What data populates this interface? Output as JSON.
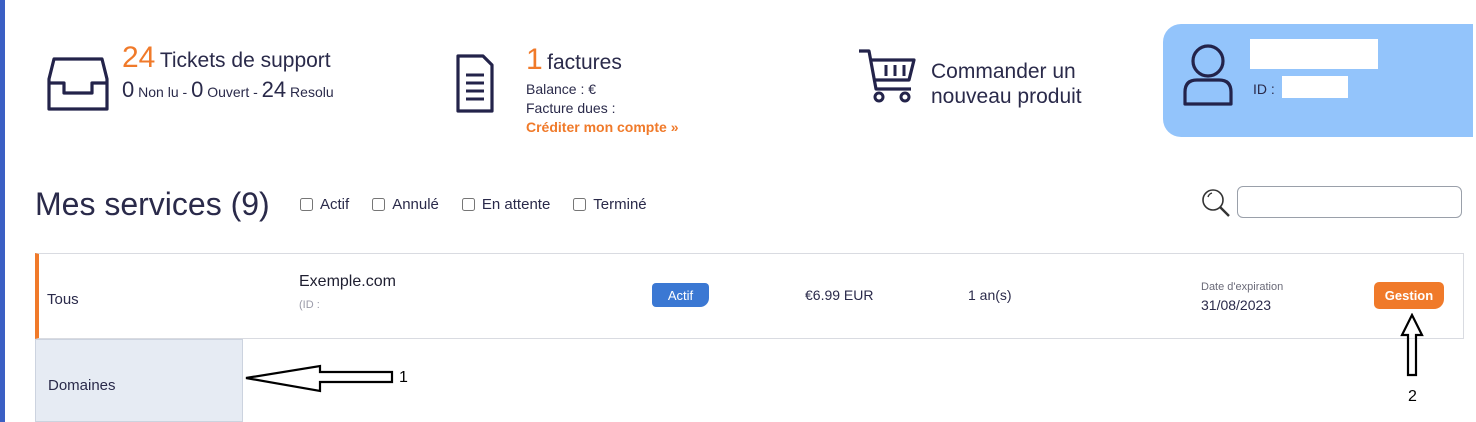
{
  "stats": {
    "tickets": {
      "count": "24",
      "title": "Tickets de support",
      "unread_count": "0",
      "unread_label": "Non lu",
      "open_count": "0",
      "open_label": "Ouvert",
      "resolved_count": "24",
      "resolved_label": "Resolu",
      "icon": "inbox-icon"
    },
    "invoices": {
      "count": "1",
      "title": "factures",
      "balance_label": "Balance : €",
      "due_label": "Facture dues :",
      "credit_link": "Créditer mon compte »",
      "icon": "invoice-icon"
    },
    "order": {
      "line1": "Commander un",
      "line2": "nouveau produit",
      "icon": "cart-icon"
    }
  },
  "user": {
    "id_label": "ID :",
    "icon": "user-icon",
    "card_color": "#93c4fb"
  },
  "services": {
    "title": "Mes services (9)",
    "filters": [
      "Actif",
      "Annulé",
      "En attente",
      "Terminé"
    ],
    "search_icon": "search-icon",
    "tabs": {
      "all": "Tous",
      "domains": "Domaines"
    },
    "rows": [
      {
        "name": "Exemple.com",
        "id_label": "(ID :",
        "status": "Actif",
        "price": "€6.99 EUR",
        "cycle": "1 an(s)",
        "expiration_label": "Date d'expiration",
        "expiration_date": "31/08/2023",
        "action": "Gestion"
      }
    ]
  },
  "annotations": {
    "arrow1_label": "1",
    "arrow2_label": "2"
  },
  "colors": {
    "accent": "#f07a2a",
    "primary": "#3b78d3",
    "text": "#2a2a4a"
  }
}
